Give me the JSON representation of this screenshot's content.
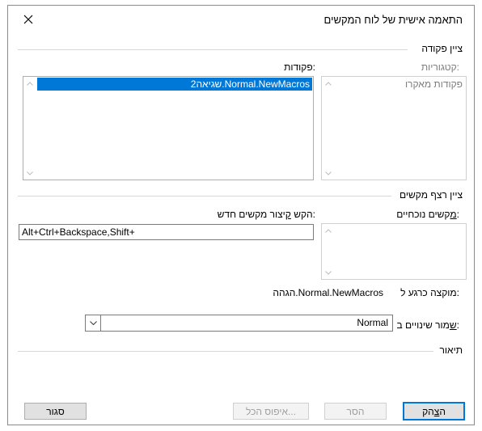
{
  "dialog": {
    "title": "התאמה אישית של לוח המקשים"
  },
  "commands_group": {
    "header": "ציין פקודה",
    "categories_label": "קטגוריות:",
    "categories_items": [
      "פקודות מאקרו"
    ],
    "commands_label": "פקודות:",
    "commands_items": [
      "Normal.NewMacros.שגיאה2"
    ]
  },
  "keys_group": {
    "header": "ציין רצף מקשים",
    "current_keys_label_accel": "מ",
    "current_keys_label_rest": "קשים נוכחיים:",
    "new_shortcut_label_pre": "הקש ",
    "new_shortcut_label_accel": "ק",
    "new_shortcut_label_post": "יצור מקשים חדש:",
    "new_shortcut_value": "Alt+Ctrl+Backspace,Shift+",
    "assigned_to_label": "מוקצה כרגע ל:",
    "assigned_to_value": "Normal.NewMacros.הגהה"
  },
  "save_changes": {
    "label_accel": "ש",
    "label_rest": "מור שינויים ב:",
    "value": "Normal"
  },
  "description": {
    "header": "תיאור"
  },
  "buttons": {
    "assign_pre": "הק",
    "assign_accel": "צ",
    "assign_post": "ה",
    "remove": "הסר",
    "reset_all": "איפוס הכל...",
    "close": "סגור"
  },
  "colors": {
    "selection": "#0078d7",
    "disabled_text": "#7d7d7d"
  }
}
